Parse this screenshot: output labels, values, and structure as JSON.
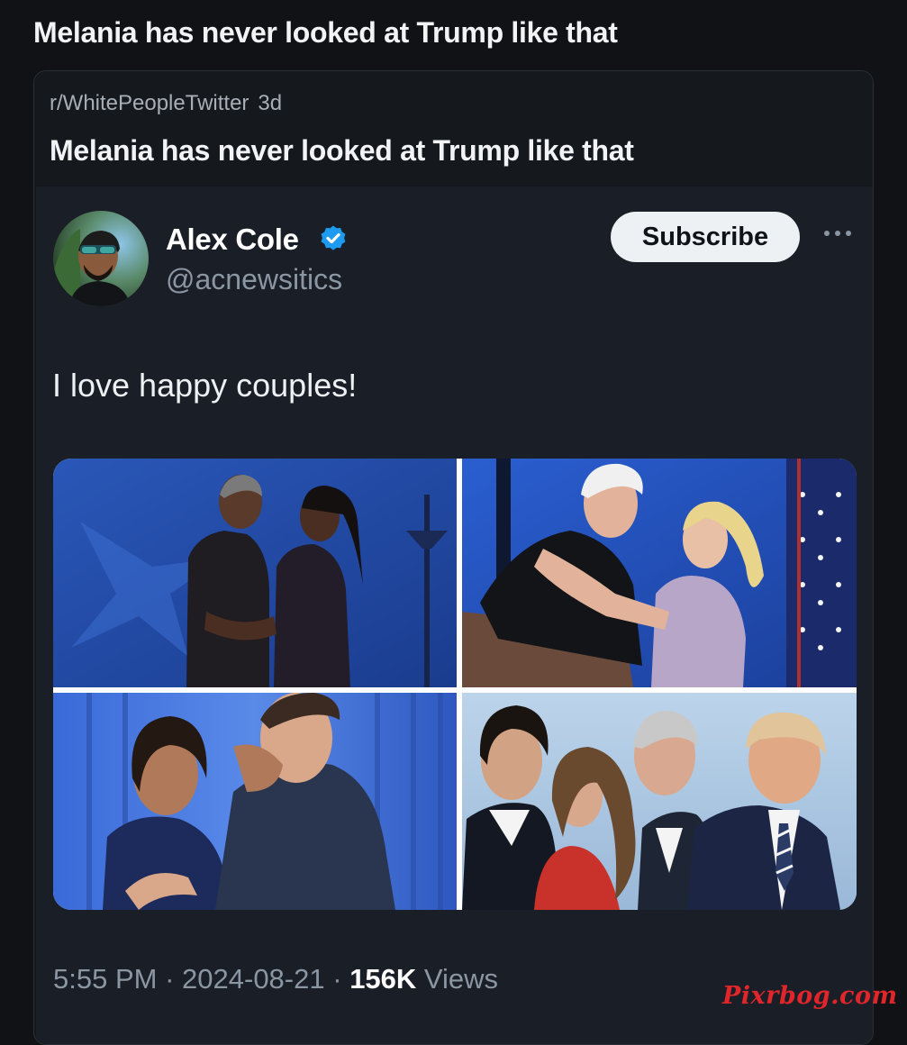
{
  "post": {
    "title": "Melania has never looked at Trump like that"
  },
  "crosspost": {
    "subreddit": "r/WhitePeopleTwitter",
    "age": "3d",
    "title": "Melania has never looked at Trump like that"
  },
  "tweet": {
    "author_name": "Alex Cole",
    "handle": "@acnewsitics",
    "subscribe_label": "Subscribe",
    "text": "I love happy couples!",
    "time": "5:55 PM",
    "date": "2024-08-21",
    "views_count": "156K",
    "views_label": "Views",
    "separator": "·"
  },
  "watermark": "Pixrbog.com",
  "colors": {
    "verified": "#1d9bf0",
    "background": "#101216",
    "tweet_bg": "#1a1e27",
    "muted": "#8b96a3"
  }
}
